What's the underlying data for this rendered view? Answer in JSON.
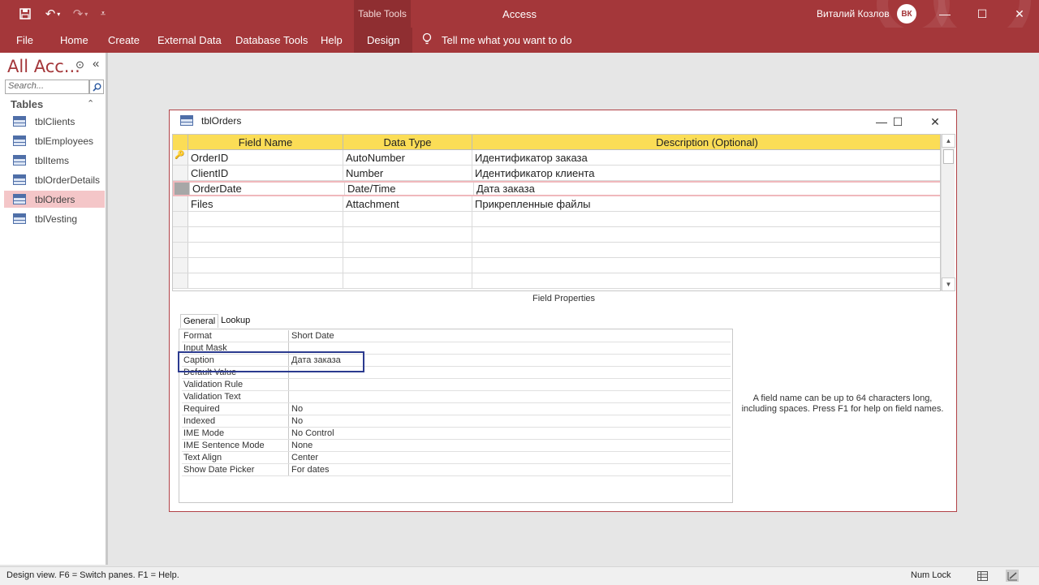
{
  "titlebar": {
    "app_title": "Access",
    "context_tab_group": "Table Tools",
    "user_name": "Виталий Козлов",
    "avatar_initials": "ВК",
    "brand_color": "#a4373a",
    "qat": {
      "save_icon": "save-icon",
      "undo_icon": "undo-icon",
      "redo_icon": "redo-icon",
      "customize_icon": "customize-qat-icon"
    },
    "window_controls": [
      "minimize-icon",
      "restore-icon",
      "close-icon"
    ]
  },
  "ribbon": {
    "tabs": [
      {
        "label": "File"
      },
      {
        "label": "Home"
      },
      {
        "label": "Create"
      },
      {
        "label": "External Data"
      },
      {
        "label": "Database Tools"
      },
      {
        "label": "Help"
      },
      {
        "label": "Design",
        "active": true
      }
    ],
    "tell_me": "Tell me what you want to do"
  },
  "nav_pane": {
    "title": "All Acc...",
    "search_placeholder": "Search...",
    "group_label": "Tables",
    "items": [
      {
        "label": "tblClients"
      },
      {
        "label": "tblEmployees"
      },
      {
        "label": "tblItems"
      },
      {
        "label": "tblOrderDetails"
      },
      {
        "label": "tblOrders",
        "selected": true
      },
      {
        "label": "tblVesting"
      }
    ]
  },
  "document": {
    "title": "tblOrders",
    "columns": [
      "Field Name",
      "Data Type",
      "Description (Optional)"
    ],
    "rows": [
      {
        "field": "OrderID",
        "type": "AutoNumber",
        "desc": "Идентификатор заказа",
        "primary_key": true
      },
      {
        "field": "ClientID",
        "type": "Number",
        "desc": "Идентификатор клиента"
      },
      {
        "field": "OrderDate",
        "type": "Date/Time",
        "desc": "Дата заказа",
        "selected": true
      },
      {
        "field": "Files",
        "type": "Attachment",
        "desc": "Прикрепленные файлы"
      }
    ],
    "field_properties_label": "Field Properties",
    "property_tabs": [
      {
        "label": "General",
        "active": true
      },
      {
        "label": "Lookup"
      }
    ],
    "properties": [
      {
        "name": "Format",
        "value": "Short Date"
      },
      {
        "name": "Input Mask",
        "value": ""
      },
      {
        "name": "Caption",
        "value": "Дата заказа"
      },
      {
        "name": "Default Value",
        "value": ""
      },
      {
        "name": "Validation Rule",
        "value": ""
      },
      {
        "name": "Validation Text",
        "value": ""
      },
      {
        "name": "Required",
        "value": "No"
      },
      {
        "name": "Indexed",
        "value": "No"
      },
      {
        "name": "IME Mode",
        "value": "No Control"
      },
      {
        "name": "IME Sentence Mode",
        "value": "None"
      },
      {
        "name": "Text Align",
        "value": "Center"
      },
      {
        "name": "Show Date Picker",
        "value": "For dates"
      }
    ],
    "help_text": "A field name can be up to 64 characters long, including spaces. Press F1 for help on field names."
  },
  "statusbar": {
    "text": "Design view.  F6 = Switch panes.  F1 = Help.",
    "num_lock": "Num Lock"
  }
}
